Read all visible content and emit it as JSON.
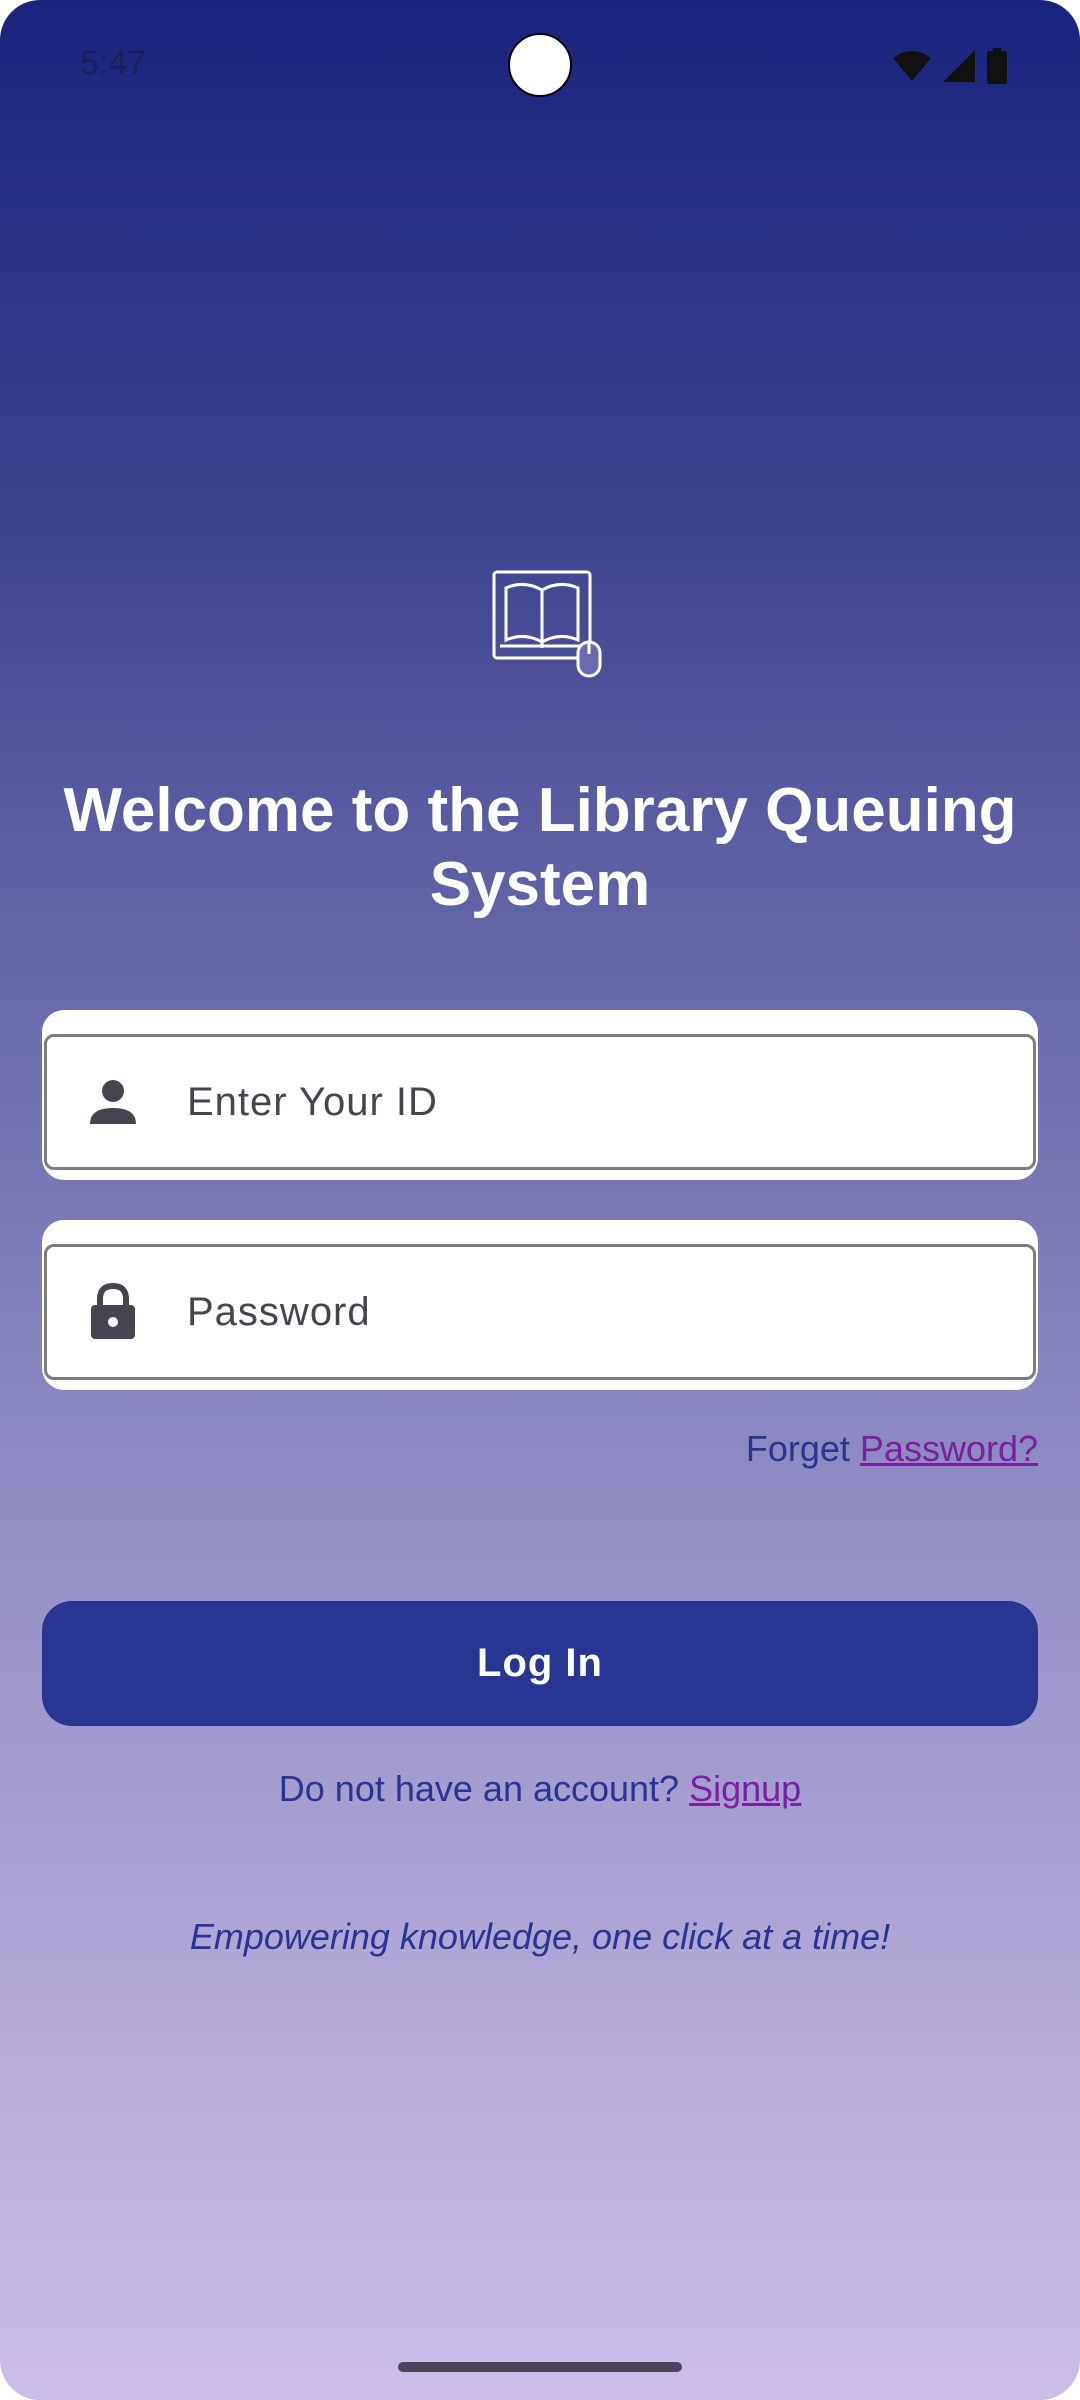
{
  "status_bar": {
    "time": "5:47",
    "icons": [
      "wifi-icon",
      "cell-signal-icon",
      "battery-icon"
    ]
  },
  "app": {
    "logo_icon": "book-computer-mouse-icon",
    "title": "Welcome to the Library Queuing System"
  },
  "form": {
    "id_field": {
      "icon": "person-icon",
      "placeholder": "Enter Your ID",
      "value": ""
    },
    "password_field": {
      "icon": "lock-icon",
      "placeholder": "Password",
      "value": ""
    },
    "forget_prefix": "Forget",
    "forget_link": "Password?",
    "login_label": "Log In"
  },
  "signup": {
    "prompt": "Do not have an account?",
    "link": "Signup"
  },
  "tagline": "Empowering knowledge, one click at a time!",
  "colors": {
    "primary": "#283593",
    "link": "#7b1fa2",
    "gradient_top": "#1a237e",
    "gradient_bottom": "#cbbde8"
  }
}
